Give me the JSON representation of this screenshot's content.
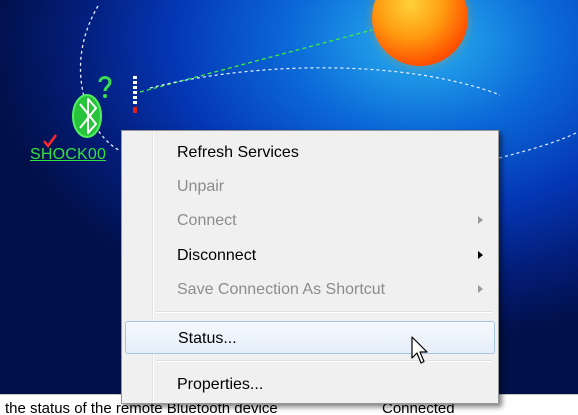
{
  "device": {
    "name": "SHOCK00"
  },
  "context_menu": {
    "items": [
      {
        "label": "Refresh Services",
        "enabled": true,
        "submenu": false
      },
      {
        "label": "Unpair",
        "enabled": false,
        "submenu": false
      },
      {
        "label": "Connect",
        "enabled": false,
        "submenu": true
      },
      {
        "label": "Disconnect",
        "enabled": true,
        "submenu": true
      },
      {
        "label": "Save Connection As Shortcut",
        "enabled": false,
        "submenu": true
      },
      {
        "label": "Status...",
        "enabled": true,
        "submenu": false,
        "hovered": true
      },
      {
        "label": "Properties...",
        "enabled": true,
        "submenu": false
      }
    ]
  },
  "status_bar": {
    "description": "the status of the remote Bluetooth device",
    "value": "Connected"
  },
  "icons": [
    "bluetooth-device-icon",
    "check-icon",
    "question-icon",
    "signal-strength-icon",
    "sun-icon",
    "mouse-cursor-icon",
    "submenu-arrow-icon"
  ],
  "colors": {
    "device_label": "#36e040",
    "menu_background": "#f0f0f0",
    "menu_hover_border": "#a7c4e6",
    "disabled_text": "#8c8c8c"
  }
}
